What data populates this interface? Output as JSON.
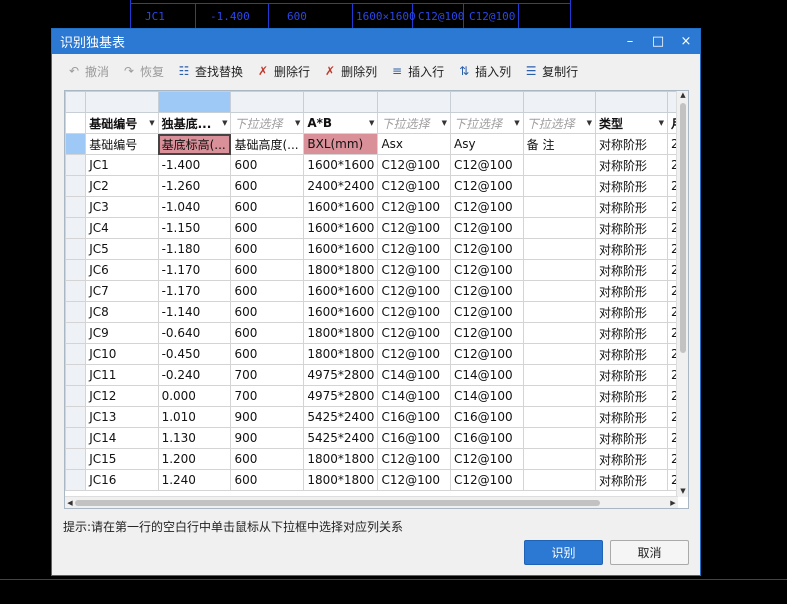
{
  "background": {
    "cad_texts": [
      "JC1",
      "-1.400",
      "600",
      "1600×1600",
      "C12@100",
      "C12@100"
    ]
  },
  "dialog": {
    "title": "识别独基表",
    "window_buttons": {
      "minimize": "–",
      "maximize": "□",
      "close": "×"
    }
  },
  "toolbar": {
    "undo": "撤消",
    "redo": "恢复",
    "find_replace": "查找替换",
    "delete_row": "删除行",
    "delete_col": "删除列",
    "insert_row": "插入行",
    "insert_col": "插入列",
    "copy_row": "复制行"
  },
  "grid": {
    "header_row1": [
      {
        "text": "基础编号",
        "placeholder": false
      },
      {
        "text": "独基底...",
        "placeholder": false
      },
      {
        "text": "下拉选择",
        "placeholder": true
      },
      {
        "text": "A*B",
        "placeholder": false
      },
      {
        "text": "下拉选择",
        "placeholder": true
      },
      {
        "text": "下拉选择",
        "placeholder": true
      },
      {
        "text": "下拉选择",
        "placeholder": true
      },
      {
        "text": "类型",
        "placeholder": false
      },
      {
        "text": "月",
        "placeholder": false
      }
    ],
    "header_row2": [
      "基础编号",
      "基底标高(...",
      "基础高度(...",
      "BXL(mm)",
      "Asx",
      "Asy",
      "备 注",
      "对称阶形",
      "2"
    ],
    "rows": [
      [
        "JC1",
        "-1.400",
        "600",
        "1600*1600",
        "C12@100",
        "C12@100",
        "",
        "对称阶形",
        "2"
      ],
      [
        "JC2",
        "-1.260",
        "600",
        "2400*2400",
        "C12@100",
        "C12@100",
        "",
        "对称阶形",
        "2"
      ],
      [
        "JC3",
        "-1.040",
        "600",
        "1600*1600",
        "C12@100",
        "C12@100",
        "",
        "对称阶形",
        "2"
      ],
      [
        "JC4",
        "-1.150",
        "600",
        "1600*1600",
        "C12@100",
        "C12@100",
        "",
        "对称阶形",
        "2"
      ],
      [
        "JC5",
        "-1.180",
        "600",
        "1600*1600",
        "C12@100",
        "C12@100",
        "",
        "对称阶形",
        "2"
      ],
      [
        "JC6",
        "-1.170",
        "600",
        "1800*1800",
        "C12@100",
        "C12@100",
        "",
        "对称阶形",
        "2"
      ],
      [
        "JC7",
        "-1.170",
        "600",
        "1600*1600",
        "C12@100",
        "C12@100",
        "",
        "对称阶形",
        "2"
      ],
      [
        "JC8",
        "-1.140",
        "600",
        "1600*1600",
        "C12@100",
        "C12@100",
        "",
        "对称阶形",
        "2"
      ],
      [
        "JC9",
        "-0.640",
        "600",
        "1800*1800",
        "C12@100",
        "C12@100",
        "",
        "对称阶形",
        "2"
      ],
      [
        "JC10",
        "-0.450",
        "600",
        "1800*1800",
        "C12@100",
        "C12@100",
        "",
        "对称阶形",
        "2"
      ],
      [
        "JC11",
        "-0.240",
        "700",
        "4975*2800",
        "C14@100",
        "C14@100",
        "",
        "对称阶形",
        "2"
      ],
      [
        "JC12",
        "0.000",
        "700",
        "4975*2800",
        "C14@100",
        "C14@100",
        "",
        "对称阶形",
        "2"
      ],
      [
        "JC13",
        "1.010",
        "900",
        "5425*2400",
        "C16@100",
        "C16@100",
        "",
        "对称阶形",
        "2"
      ],
      [
        "JC14",
        "1.130",
        "900",
        "5425*2400",
        "C16@100",
        "C16@100",
        "",
        "对称阶形",
        "2"
      ],
      [
        "JC15",
        "1.200",
        "600",
        "1800*1800",
        "C12@100",
        "C12@100",
        "",
        "对称阶形",
        "2"
      ],
      [
        "JC16",
        "1.240",
        "600",
        "1800*1800",
        "C12@100",
        "C12@100",
        "",
        "对称阶形",
        "2"
      ]
    ]
  },
  "hint": "提示:请在第一行的空白行中单击鼠标从下拉框中选择对应列关系",
  "buttons": {
    "ok": "识别",
    "cancel": "取消"
  }
}
